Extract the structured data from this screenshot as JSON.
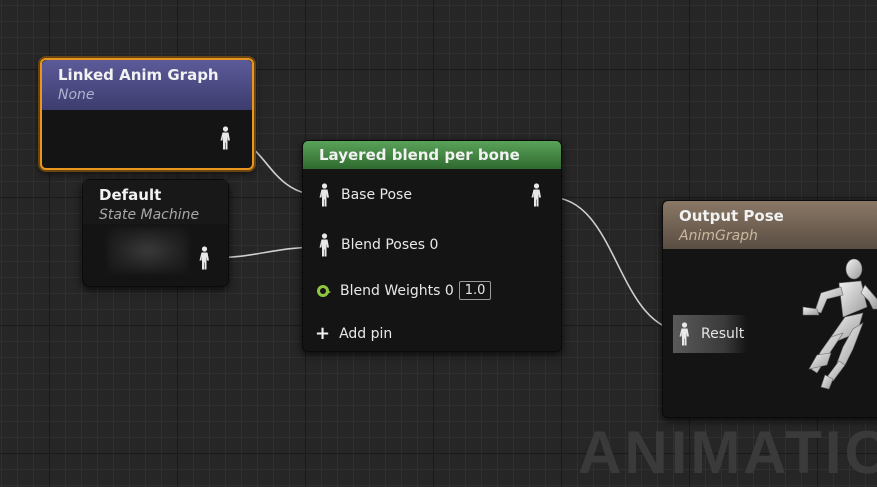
{
  "nodes": {
    "linked_anim_graph": {
      "title": "Linked Anim Graph",
      "subtitle": "None"
    },
    "default_state": {
      "title": "Default",
      "subtitle": "State Machine"
    },
    "layered_blend": {
      "title": "Layered blend per bone",
      "base_pose_label": "Base Pose",
      "blend_poses_label": "Blend Poses 0",
      "blend_weights_label": "Blend Weights 0",
      "blend_weights_value": "1.0",
      "add_pin_label": "Add pin"
    },
    "output_pose": {
      "title": "Output Pose",
      "subtitle": "AnimGraph",
      "result_label": "Result"
    }
  },
  "watermark": "ANIMATIO",
  "colors": {
    "linked_header": "#4b4a82",
    "selection_outline": "#e8961e",
    "layered_header": "#4a8a4a",
    "output_header": "#7a6a5a",
    "float_pin": "#8ec63f",
    "wire": "#cfcfcf"
  },
  "icons": {
    "pose_pin": "pose-pin-icon",
    "float_pin": "float-pin-icon",
    "add": "plus-icon",
    "mannequin": "mannequin-preview"
  }
}
